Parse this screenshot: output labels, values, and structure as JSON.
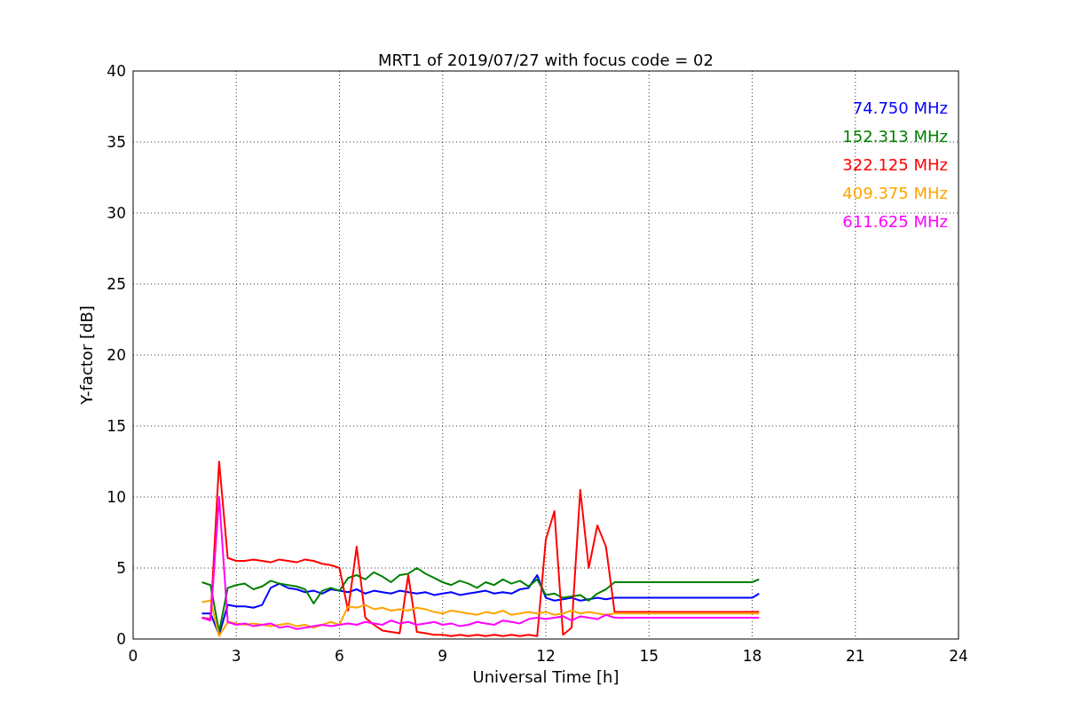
{
  "chart_data": {
    "type": "line",
    "title": "MRT1 of 2019/07/27 with focus code = 02",
    "xlabel": "Universal Time [h]",
    "ylabel": "Y-factor [dB]",
    "x": [
      2.0,
      2.25,
      2.5,
      2.75,
      3.0,
      3.25,
      3.5,
      3.75,
      4.0,
      4.25,
      4.5,
      4.75,
      5.0,
      5.25,
      5.5,
      5.75,
      6.0,
      6.25,
      6.5,
      6.75,
      7.0,
      7.25,
      7.5,
      7.75,
      8.0,
      8.25,
      8.5,
      8.75,
      9.0,
      9.25,
      9.5,
      9.75,
      10.0,
      10.25,
      10.5,
      10.75,
      11.0,
      11.25,
      11.5,
      11.75,
      12.0,
      12.25,
      12.5,
      12.75,
      13.0,
      13.25,
      13.5,
      13.75,
      14.0,
      18.0,
      18.2
    ],
    "series": [
      {
        "name": "74.750 MHz",
        "color": "#0000ff",
        "values": [
          1.8,
          1.8,
          0.3,
          2.4,
          2.3,
          2.3,
          2.2,
          2.4,
          3.6,
          3.9,
          3.6,
          3.5,
          3.3,
          3.4,
          3.2,
          3.5,
          3.4,
          3.3,
          3.5,
          3.2,
          3.4,
          3.3,
          3.2,
          3.4,
          3.3,
          3.2,
          3.3,
          3.1,
          3.2,
          3.3,
          3.1,
          3.2,
          3.3,
          3.4,
          3.2,
          3.3,
          3.2,
          3.5,
          3.6,
          4.5,
          2.9,
          2.7,
          2.8,
          2.9,
          2.7,
          2.8,
          2.9,
          2.8,
          2.9,
          2.9,
          3.2
        ]
      },
      {
        "name": "152.313 MHz",
        "color": "#008000",
        "values": [
          4.0,
          3.8,
          0.5,
          3.6,
          3.8,
          3.9,
          3.5,
          3.7,
          4.1,
          3.9,
          3.8,
          3.7,
          3.5,
          2.5,
          3.4,
          3.6,
          3.4,
          4.3,
          4.5,
          4.2,
          4.7,
          4.4,
          4.0,
          4.5,
          4.6,
          5.0,
          4.6,
          4.3,
          4.0,
          3.8,
          4.1,
          3.9,
          3.6,
          4.0,
          3.8,
          4.2,
          3.9,
          4.1,
          3.7,
          4.2,
          3.1,
          3.2,
          2.9,
          3.0,
          3.1,
          2.7,
          3.2,
          3.5,
          4.0,
          4.0,
          4.2
        ]
      },
      {
        "name": "322.125 MHz",
        "color": "#ff0000",
        "values": [
          1.5,
          1.4,
          12.5,
          5.7,
          5.5,
          5.5,
          5.6,
          5.5,
          5.4,
          5.6,
          5.5,
          5.4,
          5.6,
          5.5,
          5.3,
          5.2,
          5.0,
          2.0,
          6.5,
          1.5,
          1.0,
          0.6,
          0.5,
          0.4,
          4.5,
          0.5,
          0.4,
          0.3,
          0.3,
          0.2,
          0.3,
          0.2,
          0.3,
          0.2,
          0.3,
          0.2,
          0.3,
          0.2,
          0.3,
          0.2,
          7.0,
          9.0,
          0.3,
          0.8,
          10.5,
          5.0,
          8.0,
          6.5,
          1.9,
          1.9,
          1.9
        ]
      },
      {
        "name": "409.375 MHz",
        "color": "#ffa500",
        "values": [
          2.6,
          2.7,
          0.2,
          1.2,
          1.1,
          1.0,
          1.1,
          1.0,
          0.9,
          1.0,
          1.1,
          0.9,
          1.0,
          0.8,
          1.0,
          1.2,
          1.0,
          2.3,
          2.2,
          2.4,
          2.1,
          2.2,
          2.0,
          2.1,
          2.0,
          2.2,
          2.1,
          1.9,
          1.8,
          2.0,
          1.9,
          1.8,
          1.7,
          1.9,
          1.8,
          2.0,
          1.7,
          1.8,
          1.9,
          1.8,
          1.9,
          1.7,
          1.8,
          2.0,
          1.8,
          1.9,
          1.8,
          1.7,
          1.8,
          1.8,
          1.8
        ]
      },
      {
        "name": "611.625 MHz",
        "color": "#ff00ff",
        "values": [
          1.5,
          1.3,
          10.0,
          1.2,
          1.0,
          1.1,
          0.9,
          1.0,
          1.1,
          0.8,
          0.9,
          0.7,
          0.8,
          0.9,
          1.0,
          0.9,
          1.0,
          1.1,
          1.0,
          1.2,
          1.1,
          1.0,
          1.3,
          1.1,
          1.2,
          1.0,
          1.1,
          1.2,
          1.0,
          1.1,
          0.9,
          1.0,
          1.2,
          1.1,
          1.0,
          1.3,
          1.2,
          1.1,
          1.4,
          1.5,
          1.4,
          1.5,
          1.6,
          1.3,
          1.6,
          1.5,
          1.4,
          1.7,
          1.5,
          1.5,
          1.5
        ]
      }
    ],
    "xlim": [
      0,
      24
    ],
    "ylim": [
      0,
      40
    ],
    "xticks": [
      0,
      3,
      6,
      9,
      12,
      15,
      18,
      21,
      24
    ],
    "yticks": [
      0,
      5,
      10,
      15,
      20,
      25,
      30,
      35,
      40
    ],
    "grid": true
  }
}
